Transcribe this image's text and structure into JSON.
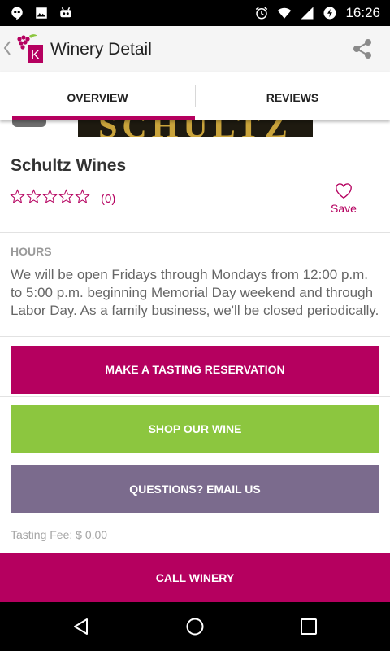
{
  "status_bar": {
    "time": "16:26",
    "icons_left": [
      "hangouts-icon",
      "image-icon",
      "android-robot-icon"
    ],
    "icons_right": [
      "alarm-icon",
      "wifi-icon",
      "cell-signal-icon",
      "battery-charging-icon"
    ]
  },
  "app_bar": {
    "title": "Winery Detail",
    "logo_letter": "K"
  },
  "tabs": [
    {
      "label": "OVERVIEW",
      "active": true
    },
    {
      "label": "REVIEWS",
      "active": false
    }
  ],
  "banner": {
    "text": "SCHULTZ"
  },
  "winery": {
    "name": "Schultz Wines",
    "stars": 0,
    "max_stars": 5,
    "rating_count": "(0)",
    "save_label": "Save"
  },
  "hours": {
    "label": "HOURS",
    "text": "We will be open Fridays through Mondays from 12:00 p.m. to 5:00 p.m. beginning Memorial Day weekend and through Labor Day. As a family business, we'll be closed periodically."
  },
  "actions": {
    "reserve_label": "MAKE A TASTING RESERVATION",
    "shop_label": "SHOP OUR WINE",
    "email_label": "QUESTIONS? EMAIL US"
  },
  "tasting_fee": "Tasting Fee: $ 0.00",
  "call_label": "CALL WINERY",
  "colors": {
    "accent": "#b5005f",
    "shop_green": "#8cc63f",
    "email_purple": "#7b6b8d"
  }
}
